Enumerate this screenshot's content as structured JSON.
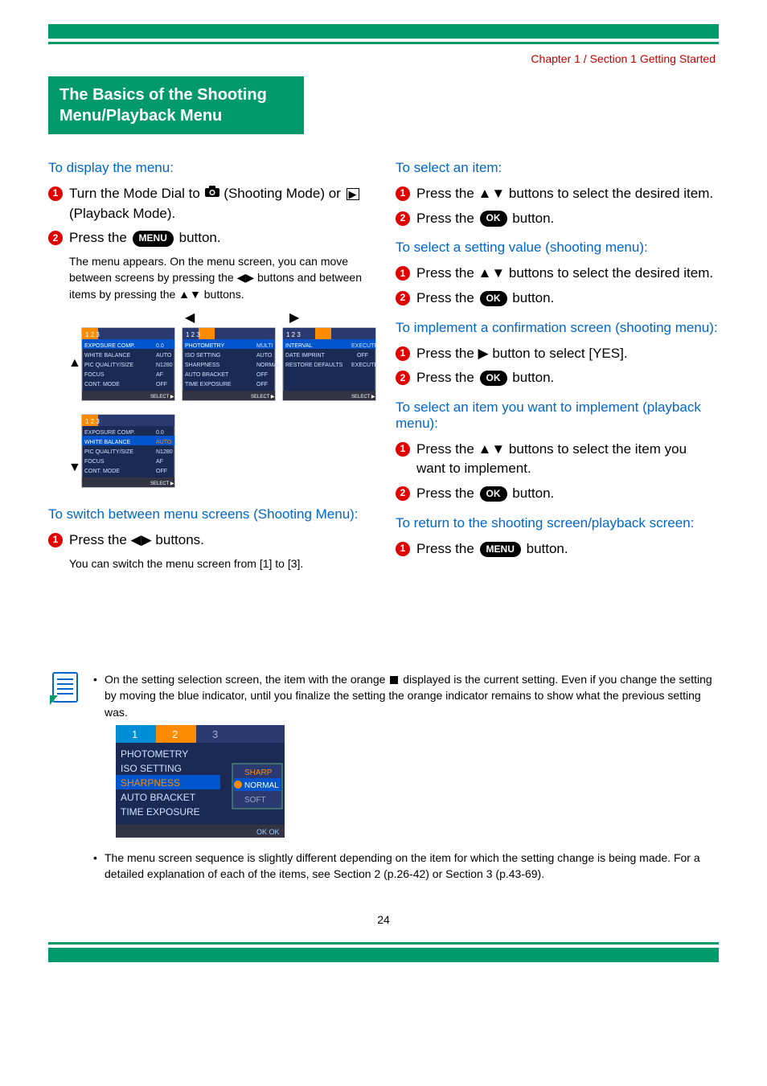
{
  "chapter_line": "Chapter 1 / Section 1 Getting Started",
  "title_line1": "The Basics of the Shooting",
  "title_line2": "Menu/Playback Menu",
  "left": {
    "h_display": "To display the menu:",
    "s1a": "Turn the Mode Dial to ",
    "s1b": " (Shooting Mode) or ",
    "s1c": " (Playback Mode).",
    "s2a": "Press the ",
    "s2b": " button.",
    "s2_sub": "The menu appears. On the menu screen, you can move between screens by pressing the ◀▶ buttons and between items by pressing the ▲▼ buttons.",
    "h_switch": "To switch between menu screens (Shooting Menu):",
    "sw1": "Press the ◀▶ buttons.",
    "sw1_sub": "You can switch the menu screen from [1] to [3]."
  },
  "right": {
    "h_select_item": "To select an item:",
    "si1": "Press the ▲▼ buttons to select the desired item.",
    "si2a": "Press the ",
    "si2b": " button.",
    "h_select_val": "To select a setting value (shooting menu):",
    "sv1": "Press the ▲▼ buttons to select the desired item.",
    "sv2a": "Press the ",
    "sv2b": " button.",
    "h_confirm": "To implement a confirmation screen (shooting menu):",
    "cf1": "Press the ▶ button to select [YES].",
    "cf2a": "Press the ",
    "cf2b": " button.",
    "h_playback": "To select an item you want to implement (playback menu):",
    "pb1": "Press the ▲▼ buttons to select the item you want to implement.",
    "pb2a": "Press the ",
    "pb2b": " button.",
    "h_return": "To return to the shooting screen/playback screen:",
    "rt1a": "Press the ",
    "rt1b": " button."
  },
  "labels": {
    "menu": "MENU",
    "ok": "OK"
  },
  "illus": {
    "screen1": {
      "tab": "1  2  3",
      "rows": [
        "EXPOSURE COMP.",
        "WHITE BALANCE",
        "PIC QUALITY/SIZE",
        "FOCUS",
        "CONT. MODE"
      ],
      "vals": [
        "0.0",
        "AUTO",
        "N1280",
        "AF",
        "OFF"
      ]
    },
    "screen2": {
      "tab": "1  2  3",
      "rows": [
        "PHOTOMETRY",
        "ISO SETTING",
        "SHARPNESS",
        "AUTO BRACKET",
        "TIME EXPOSURE"
      ],
      "vals": [
        "MULTI",
        "AUTO",
        "NORMAL",
        "OFF",
        "OFF"
      ]
    },
    "screen3": {
      "tab": "1  2  3",
      "rows": [
        "INTERVAL",
        "DATE IMPRINT",
        "RESTORE DEFAULTS"
      ],
      "vals": [
        "EXECUTE",
        "OFF",
        "EXECUTE"
      ]
    },
    "screen4": {
      "tab": "1  2  3",
      "rows": [
        "EXPOSURE COMP.",
        "WHITE BALANCE",
        "PIC QUALITY/SIZE",
        "FOCUS",
        "CONT. MODE"
      ],
      "vals": [
        "0.0",
        "AUTO",
        "N1280",
        "AF",
        "OFF"
      ]
    },
    "note_screen": {
      "tab": "1  2  3",
      "rows": [
        "PHOTOMETRY",
        "ISO SETTING",
        "SHARPNESS",
        "AUTO BRACKET",
        "TIME EXPOSURE"
      ],
      "sel": [
        "SHARP",
        "NORMAL",
        "SOFT"
      ]
    }
  },
  "notes": {
    "n1a": "On the setting selection screen, the item with the orange ",
    "n1b": " displayed is the current setting. Even if you change the setting by moving the blue indicator, until you finalize the setting the orange indicator remains to show what the previous setting was.",
    "n2": "The menu screen sequence is slightly different depending on the item for which the setting change is being made. For a detailed explanation of each of the items, see Section 2 (p.26-42) or Section 3 (p.43-69)."
  },
  "page_num": "24"
}
